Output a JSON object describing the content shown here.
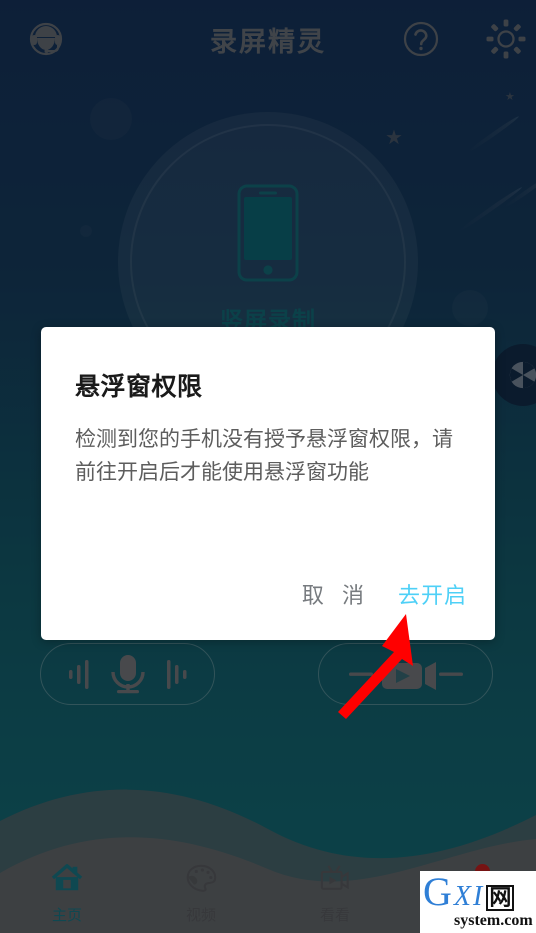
{
  "header": {
    "title": "录屏精灵",
    "support_icon": "headset-support-icon",
    "help_icon": "question-mark-icon",
    "settings_icon": "gear-icon"
  },
  "main": {
    "record_label": "竖屏录制",
    "record_icon": "phone-portrait-icon",
    "aperture_icon": "camera-aperture-icon",
    "mic_button_icon": "microphone-icon",
    "camera_button_icon": "video-camera-icon"
  },
  "dialog": {
    "title": "悬浮窗权限",
    "message": "检测到您的手机没有授予悬浮窗权限，请前往开启后才能使用悬浮窗功能",
    "cancel_label": "取 消",
    "confirm_label": "去开启",
    "confirm_color": "#4ed0f7",
    "cancel_color": "#777b7f"
  },
  "bottom_nav": {
    "items": [
      {
        "label": "主页",
        "icon": "home-icon",
        "active": true,
        "badge": false
      },
      {
        "label": "视频",
        "icon": "palette-icon",
        "active": false,
        "badge": false
      },
      {
        "label": "看看",
        "icon": "video-camera-icon",
        "active": false,
        "badge": false
      },
      {
        "label": "",
        "icon": "account-icon",
        "active": false,
        "badge": true
      }
    ],
    "active_color": "#1b7c8c",
    "inactive_color": "#5f6166"
  },
  "annotation": {
    "arrow_color": "#ff0000",
    "points_to": "去开启"
  },
  "watermark": {
    "letter": "G",
    "mid": "XI",
    "cn": "网",
    "domain": "system.com"
  }
}
